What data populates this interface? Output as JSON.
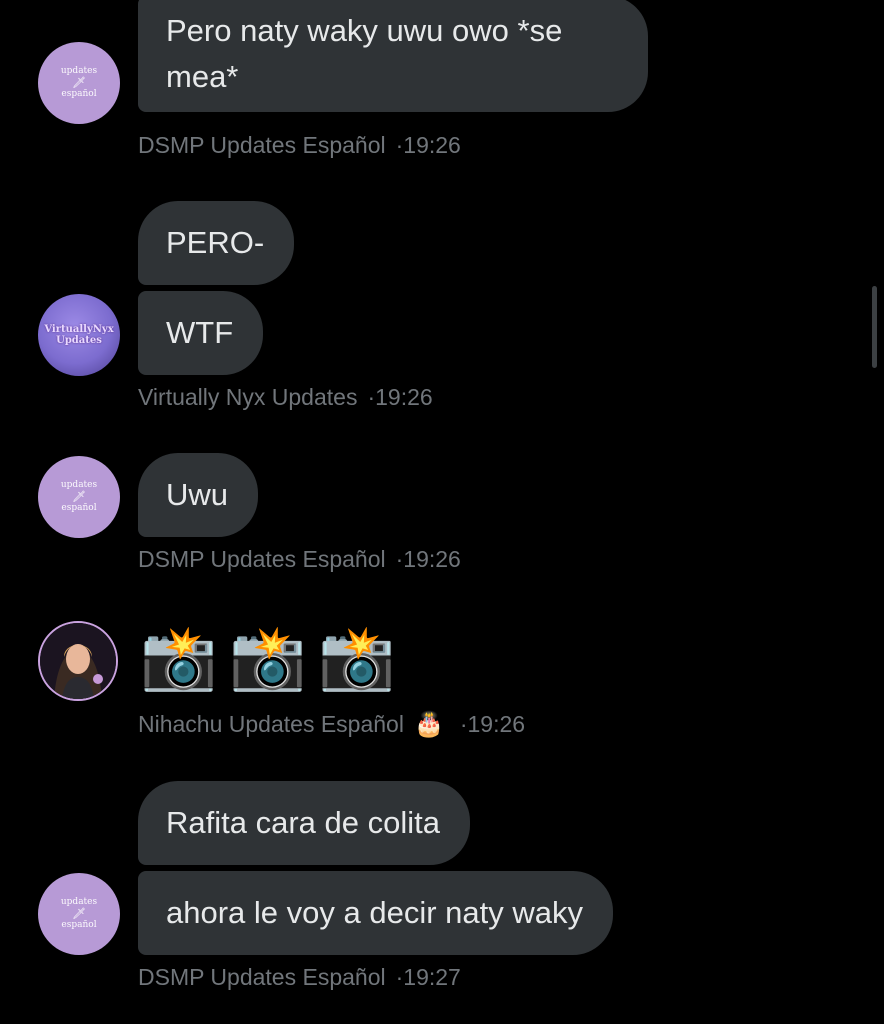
{
  "messages": [
    {
      "sender": "DSMP Updates Español",
      "time": "19:26",
      "bubbles": [
        "Pero naty waky uwu owo *se mea*"
      ],
      "avatar": {
        "text_top": "updates",
        "text_bottom": "español",
        "icon": "sword-icon"
      }
    },
    {
      "sender": "Virtually Nyx Updates",
      "time": "19:26",
      "bubbles": [
        "PERO-",
        "WTF"
      ],
      "avatar": {
        "text_top": "VirtuallyNyx",
        "text_bottom": "Updates"
      }
    },
    {
      "sender": "DSMP Updates Español",
      "time": "19:26",
      "bubbles": [
        "Uwu"
      ],
      "avatar": {
        "text_top": "updates",
        "text_bottom": "español",
        "icon": "sword-icon"
      }
    },
    {
      "sender": "Nihachu Updates Español",
      "time": "19:26",
      "sender_badge": "🎂",
      "emojis": [
        "📸",
        "📸",
        "📸"
      ],
      "avatar": {
        "icon": "profile-photo"
      }
    },
    {
      "sender": "DSMP Updates Español",
      "time": "19:27",
      "bubbles": [
        "Rafita cara de colita",
        "ahora le voy a decir naty waky"
      ],
      "avatar": {
        "text_top": "updates",
        "text_bottom": "español",
        "icon": "sword-icon"
      }
    }
  ],
  "separator": "·",
  "colors": {
    "background": "#000000",
    "bubble": "#2f3336",
    "text": "#e7e9ea",
    "meta": "#71767b",
    "dsmp_avatar": "#b79ad6"
  }
}
